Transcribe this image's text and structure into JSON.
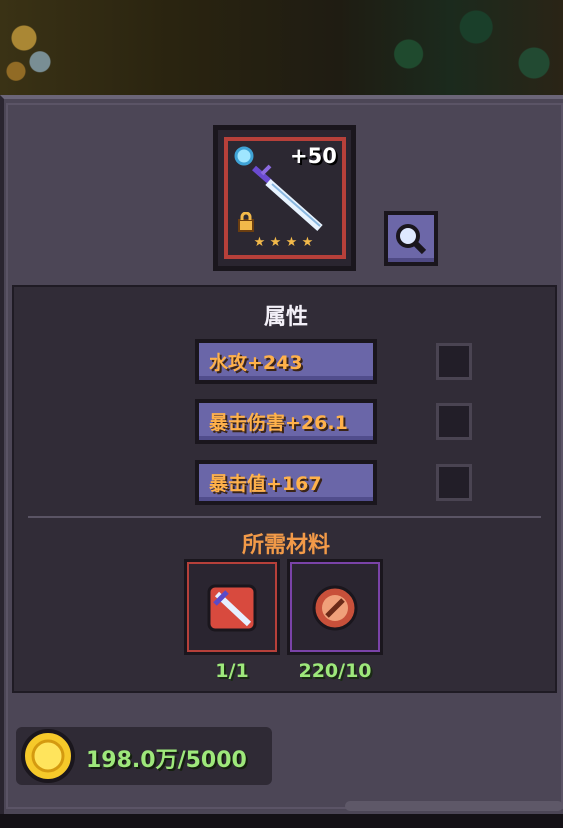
{
  "item": {
    "level": "+50",
    "name_icon": "ice-sword-icon",
    "stars": [
      "★",
      "★",
      "★",
      "★"
    ],
    "locked": true
  },
  "attributes": {
    "title": "属性",
    "rows": [
      {
        "label": "水攻+243"
      },
      {
        "label": "暴击伤害+26.1"
      },
      {
        "label": "暴击值+167"
      }
    ]
  },
  "materials": {
    "title": "所需材料",
    "items": [
      {
        "icon": "sword-material-icon",
        "count": "1/1",
        "frame_color": "#b6403a"
      },
      {
        "icon": "enhance-stone-icon",
        "count": "220/10",
        "frame_color": "#7a43a8"
      }
    ]
  },
  "currency": {
    "icon": "gold-coin-icon",
    "amount": "198.0万/5000"
  },
  "colors": {
    "accent_orange": "#ffb14a",
    "accent_green": "#9ee87b",
    "button_purple": "#6a66a8",
    "rarity_red": "#b6403a"
  }
}
